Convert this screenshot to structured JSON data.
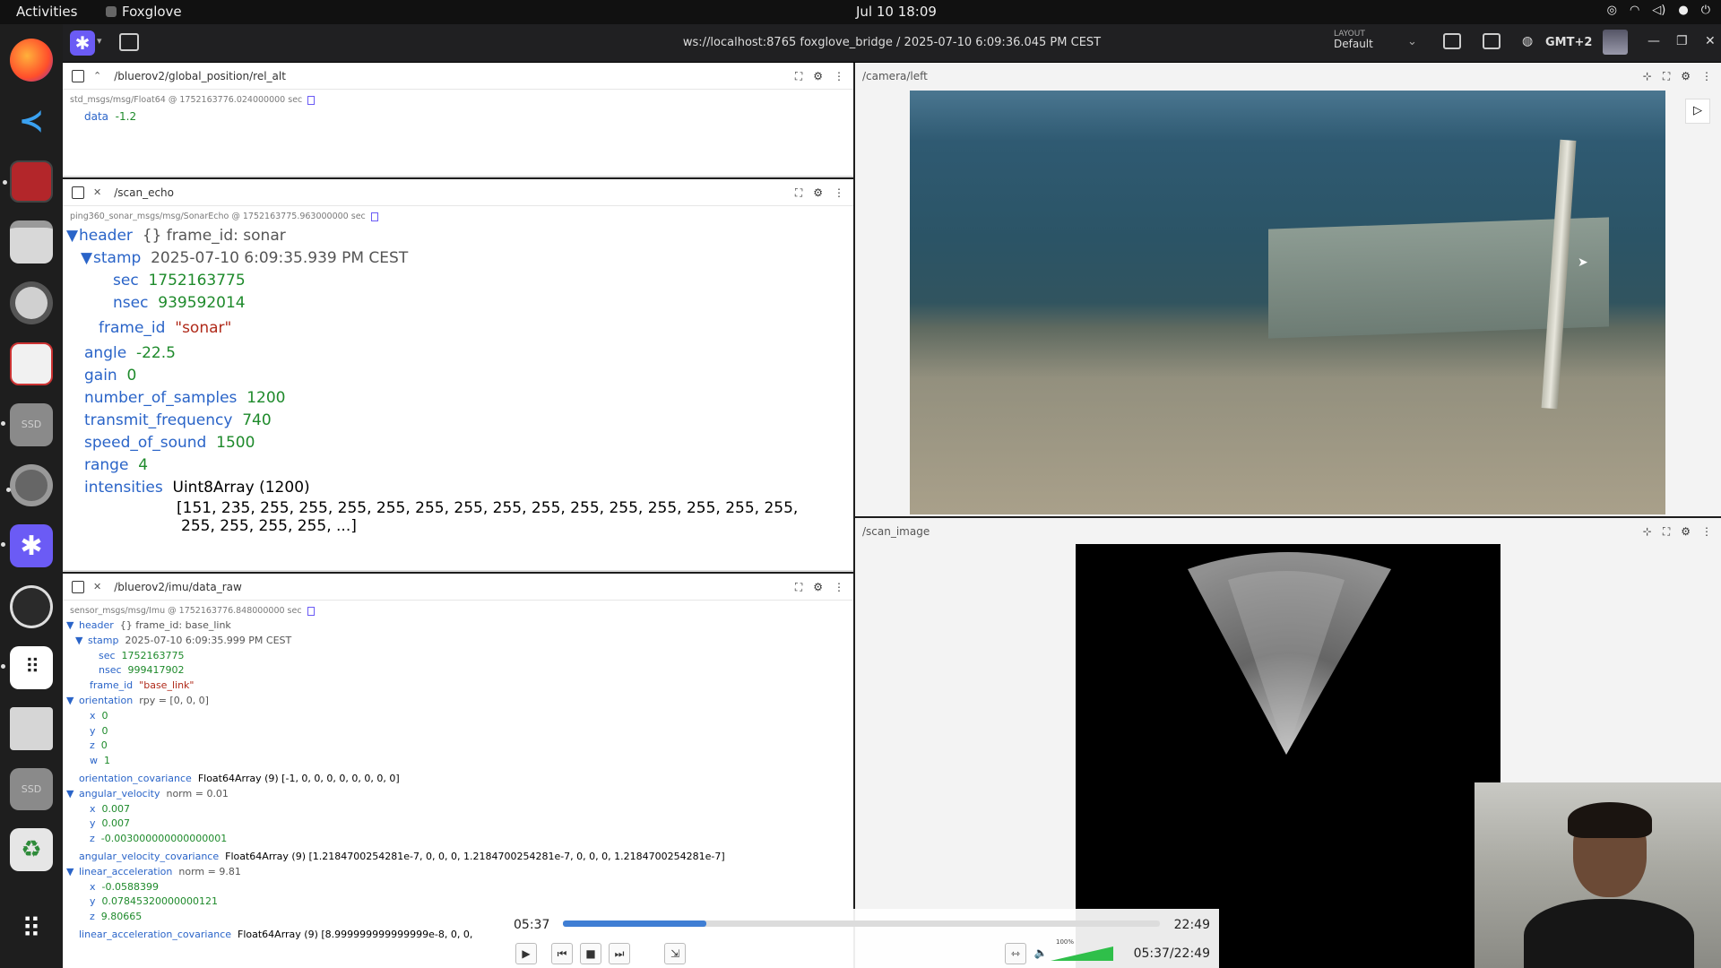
{
  "topbar": {
    "activities": "Activities",
    "app_name": "Foxglove",
    "clock": "Jul 10  18:09"
  },
  "dock": {
    "items": [
      "firefox-icon",
      "vscode-icon",
      "app-icon",
      "files-icon",
      "disk-utility-icon",
      "document-viewer-icon",
      "ssd-drive-icon",
      "settings-icon",
      "foxglove-icon",
      "obs-icon",
      "launcher-dots-icon",
      "text-file-icon",
      "ssd-drive-icon",
      "trash-icon",
      "show-apps-icon"
    ],
    "ssd_label": "SSD"
  },
  "header": {
    "title": "ws://localhost:8765 foxglove_bridge / 2025-07-10 6:09:36.045 PM CEST",
    "layout_caption": "LAYOUT",
    "layout_name": "Default",
    "timezone": "GMT+2"
  },
  "panel_rel_alt": {
    "topic": "/bluerov2/global_position/rel_alt",
    "meta": "std_msgs/msg/Float64 @ 1752163776.024000000 sec",
    "data_key": "data",
    "data_value": "-1.2"
  },
  "panel_scan_echo": {
    "topic": "/scan_echo",
    "meta": "ping360_sonar_msgs/msg/SonarEcho @ 1752163775.963000000 sec",
    "header_key": "header",
    "header_summary": "{}  frame_id: sonar",
    "stamp_key": "stamp",
    "stamp_value": "2025-07-10 6:09:35.939 PM CEST",
    "sec_key": "sec",
    "sec_value": "1752163775",
    "nsec_key": "nsec",
    "nsec_value": "939592014",
    "frame_id_key": "frame_id",
    "frame_id_value": "\"sonar\"",
    "angle_key": "angle",
    "angle_value": "-22.5",
    "gain_key": "gain",
    "gain_value": "0",
    "samples_key": "number_of_samples",
    "samples_value": "1200",
    "freq_key": "transmit_frequency",
    "freq_value": "740",
    "sound_key": "speed_of_sound",
    "sound_value": "1500",
    "range_key": "range",
    "range_value": "4",
    "intensities_key": "intensities",
    "intensities_type": "Uint8Array (1200)",
    "intensities_line1": "[151, 235, 255, 255, 255, 255, 255, 255, 255, 255, 255, 255, 255, 255, 255, 255,",
    "intensities_line2": "255, 255, 255, 255, ...]"
  },
  "panel_imu": {
    "topic": "/bluerov2/imu/data_raw",
    "meta": "sensor_msgs/msg/Imu @ 1752163776.848000000 sec",
    "header_key": "header",
    "header_summary": "{}  frame_id: base_link",
    "stamp_key": "stamp",
    "stamp_value": "2025-07-10 6:09:35.999 PM CEST",
    "sec_key": "sec",
    "sec_value": "1752163775",
    "nsec_key": "nsec",
    "nsec_value": "999417902",
    "frame_id_key": "frame_id",
    "frame_id_value": "\"base_link\"",
    "orientation_key": "orientation",
    "orientation_summary": "rpy = [0, 0, 0]",
    "ox": "0",
    "oy": "0",
    "oz": "0",
    "ow": "1",
    "orientation_cov_key": "orientation_covariance",
    "orientation_cov_value": "Float64Array (9) [-1, 0, 0, 0, 0, 0, 0, 0, 0]",
    "angvel_key": "angular_velocity",
    "angvel_summary": "norm = 0.01",
    "avx": "0.007",
    "avy": "0.007",
    "avz": "-0.003000000000000001",
    "angvel_cov_key": "angular_velocity_covariance",
    "angvel_cov_value": "Float64Array (9) [1.2184700254281e-7, 0, 0, 0, 1.2184700254281e-7, 0, 0, 0, 1.2184700254281e-7]",
    "linacc_key": "linear_acceleration",
    "linacc_summary": "norm = 9.81",
    "lax": "-0.0588399",
    "lay": "0.07845320000000121",
    "laz": "9.80665",
    "linacc_cov_key": "linear_acceleration_covariance",
    "linacc_cov_value": "Float64Array (9) [8.999999999999999e-8, 0, 0,"
  },
  "panel_camera": {
    "topic": "/camera/left"
  },
  "panel_scan_image": {
    "topic": "/scan_image"
  },
  "playback": {
    "current": "05:37",
    "total": "22:49",
    "progress": 0.24,
    "combined": "05:37/22:49",
    "volume_label": "100%",
    "volume_level": 1.0
  },
  "axes_labels": {
    "x": "x",
    "y": "y",
    "z": "z",
    "w": "w"
  }
}
